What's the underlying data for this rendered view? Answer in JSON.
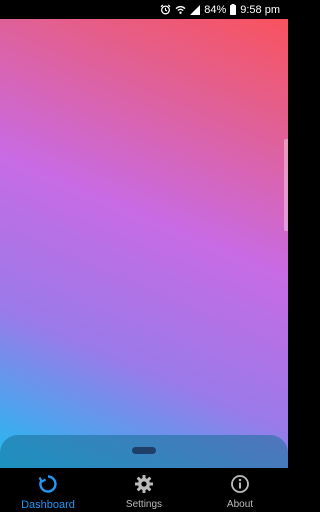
{
  "status_bar": {
    "battery_percent": "84%",
    "time": "9:58 pm",
    "icons": [
      "alarm-icon",
      "wifi-icon",
      "signal-icon",
      "battery-icon"
    ]
  },
  "nav": {
    "items": [
      {
        "label": "Dashboard",
        "icon": "refresh-icon",
        "active": true
      },
      {
        "label": "Settings",
        "icon": "gear-icon",
        "active": false
      },
      {
        "label": "About",
        "icon": "info-icon",
        "active": false
      }
    ]
  },
  "colors": {
    "accent": "#2196f3",
    "gradient_top_right": "#f9535e",
    "gradient_middle": "#c86be4",
    "gradient_bottom_left": "#1dbdf0"
  }
}
